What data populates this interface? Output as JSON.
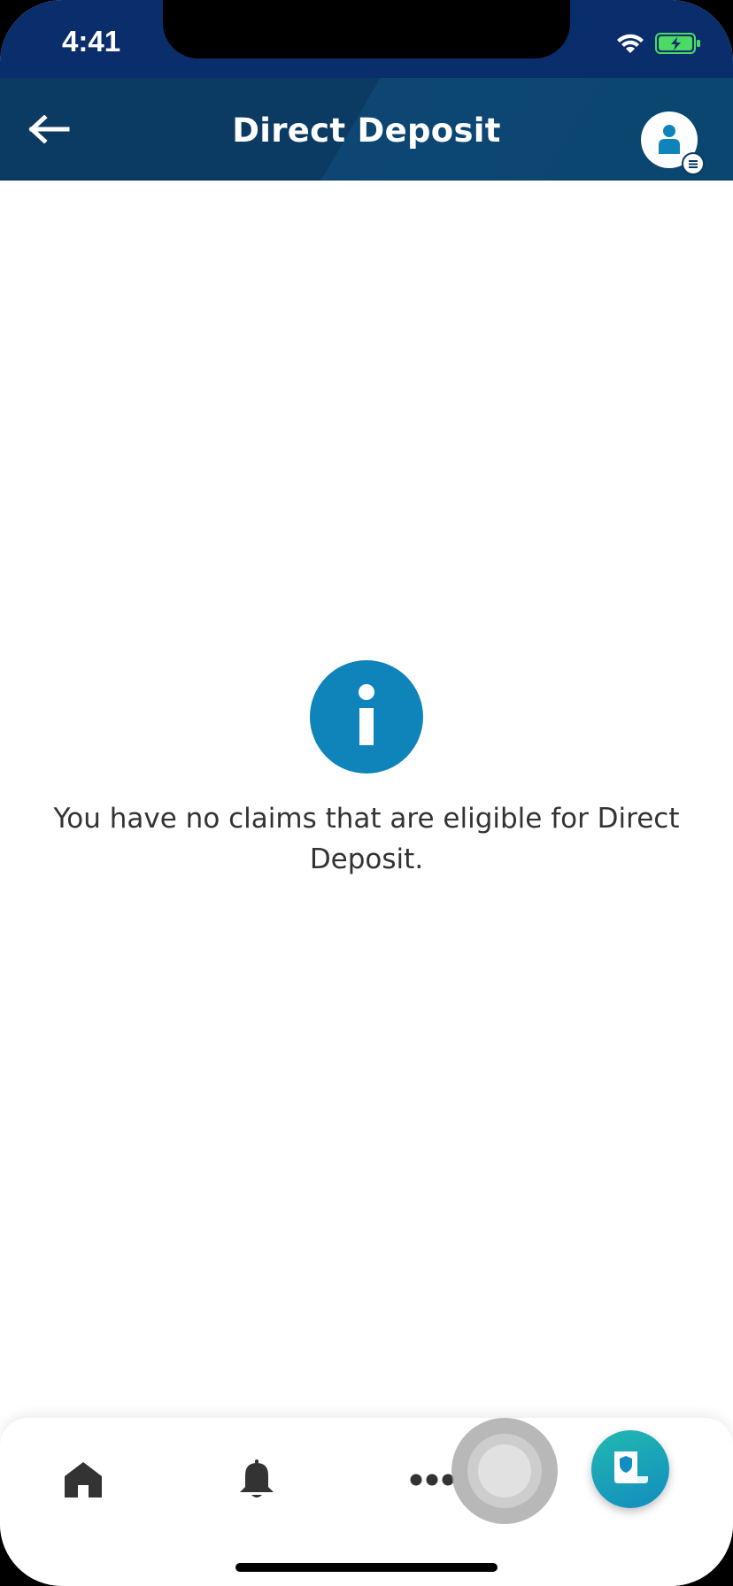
{
  "status_bar": {
    "time": "4:41",
    "icons": [
      "wifi-icon",
      "battery-charging-icon"
    ],
    "background": "#0a2d6c"
  },
  "header": {
    "title": "Direct Deposit",
    "back_icon": "back-arrow-icon",
    "profile_icon": "profile-menu-icon",
    "background": "#0b3a63"
  },
  "empty_state": {
    "icon": "info-icon",
    "icon_color": "#0e84bb",
    "message": "You have no claims that are eligible for Direct Deposit."
  },
  "bottom_nav": {
    "items": [
      {
        "icon": "home-icon"
      },
      {
        "icon": "bell-icon"
      },
      {
        "icon": "more-icon"
      }
    ],
    "fab_icon": "claims-icon",
    "fab_colors": [
      "#22b8b0",
      "#128dbf"
    ]
  }
}
